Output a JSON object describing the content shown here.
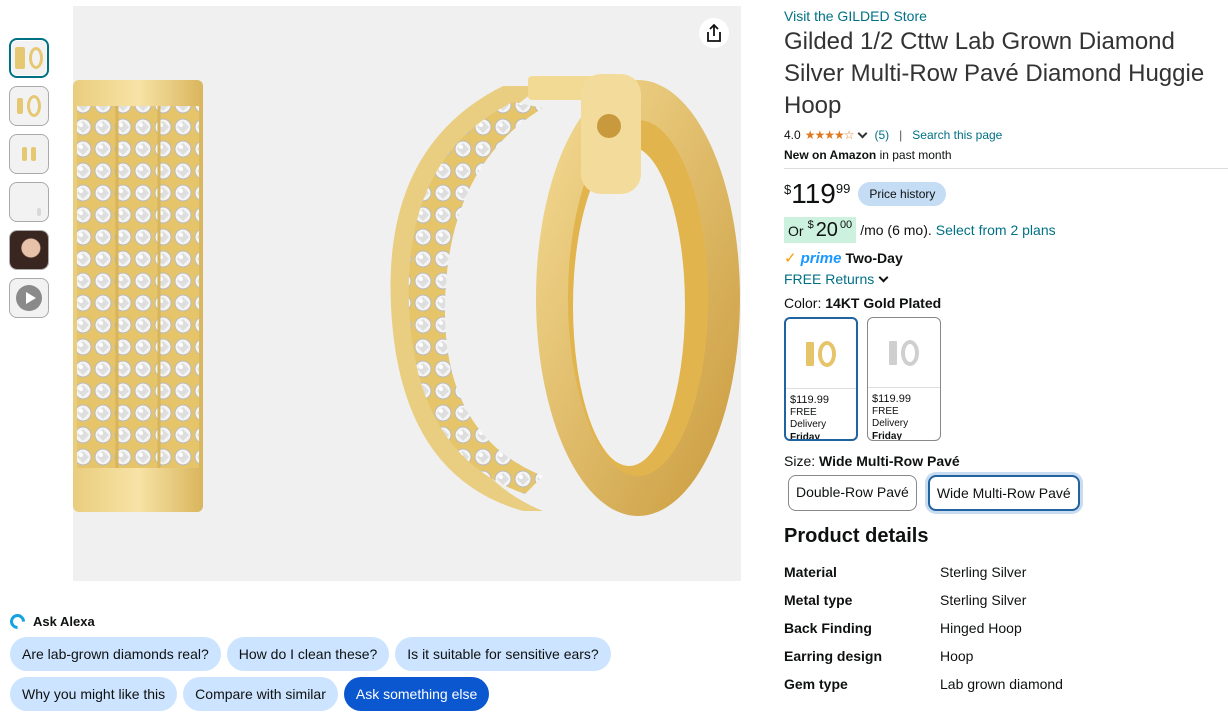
{
  "thumbnails": [
    {
      "kind": "gold-hoops",
      "active": true
    },
    {
      "kind": "gold-ring",
      "active": false
    },
    {
      "kind": "gold-side",
      "active": false
    },
    {
      "kind": "silver-detail",
      "active": false
    },
    {
      "kind": "model-photo",
      "active": false
    },
    {
      "kind": "video",
      "active": false
    }
  ],
  "main_image": {
    "alt": "gold-multi-row-pave-huggie-hoop-earrings",
    "share_icon": "share-icon"
  },
  "alexa": {
    "title": "Ask Alexa",
    "chips_row1": [
      "Are lab-grown diamonds real?",
      "How do I clean these?",
      "Is it suitable for sensitive ears?"
    ],
    "chips_row2": [
      "Why you might like this",
      "Compare with similar"
    ],
    "primary_chip": "Ask something else"
  },
  "product": {
    "store_link": "Visit the GILDED Store",
    "title": "Gilded 1/2 Cttw Lab Grown Diamond Silver Multi-Row Pavé Diamond Huggie Hoop",
    "rating": "4.0",
    "stars": "★★★★☆",
    "review_count": "(5)",
    "search_page": "Search this page",
    "new_on_amazon": "New on Amazon",
    "new_suffix": " in past month",
    "price_symbol": "$",
    "price_whole": "119",
    "price_fraction": "99",
    "price_history": "Price history",
    "monthly_prefix": "Or ",
    "monthly_symbol": "$",
    "monthly_whole": "20",
    "monthly_fraction": "00",
    "monthly_suffix": "/mo (6 mo).",
    "monthly_link": "Select from 2 plans",
    "prime_check": "✓",
    "prime_word": "prime",
    "prime_speed": "Two-Day",
    "returns": "FREE Returns",
    "color_label": "Color:",
    "color_value": "14KT Gold Plated",
    "swatches": [
      {
        "price": "$119.99",
        "delivery": "FREE Delivery",
        "day": "Friday",
        "selected": true
      },
      {
        "price": "$119.99",
        "delivery": "FREE Delivery",
        "day": "Friday",
        "selected": false
      }
    ],
    "size_label": "Size:",
    "size_value": "Wide Multi-Row Pavé",
    "sizes": [
      "Double-Row Pavé",
      "Wide Multi-Row Pavé"
    ],
    "details_title": "Product details",
    "details": [
      {
        "k": "Material",
        "v": "Sterling Silver"
      },
      {
        "k": "Metal type",
        "v": "Sterling Silver"
      },
      {
        "k": "Back Finding",
        "v": "Hinged Hoop"
      },
      {
        "k": "Earring design",
        "v": "Hoop"
      },
      {
        "k": "Gem type",
        "v": "Lab grown diamond"
      }
    ]
  },
  "colors": {
    "link": "#007185",
    "accent_blue": "#0b57d0",
    "gold": "#e5c46a",
    "star": "#de7921"
  }
}
